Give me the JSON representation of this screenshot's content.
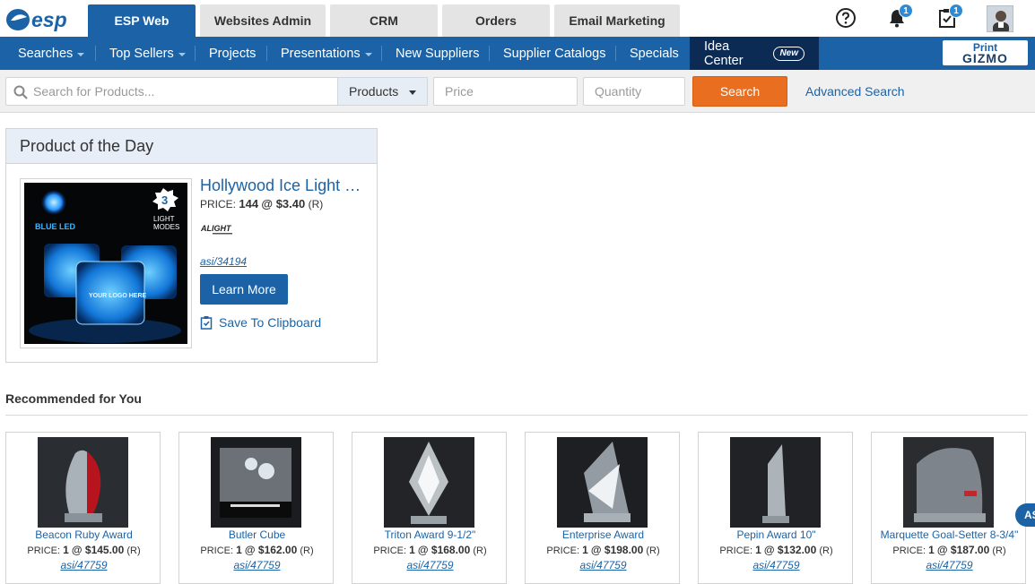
{
  "brand": {
    "logo_text": "esp"
  },
  "app_tabs": [
    {
      "label": "ESP Web",
      "active": true
    },
    {
      "label": "Websites Admin",
      "active": false
    },
    {
      "label": "CRM",
      "active": false
    },
    {
      "label": "Orders",
      "active": false
    },
    {
      "label": "Email Marketing",
      "active": false
    }
  ],
  "header_icons": {
    "help": "help-icon",
    "notifications": {
      "icon": "bell-icon",
      "count": "1"
    },
    "tasks": {
      "icon": "clipboard-check-icon",
      "count": "1"
    }
  },
  "nav": {
    "items": [
      {
        "label": "Searches",
        "dropdown": true
      },
      {
        "label": "Top Sellers",
        "dropdown": true
      },
      {
        "label": "Projects",
        "dropdown": false
      },
      {
        "label": "Presentations",
        "dropdown": true
      },
      {
        "label": "New Suppliers",
        "dropdown": false
      },
      {
        "label": "Supplier Catalogs",
        "dropdown": false
      },
      {
        "label": "Specials",
        "dropdown": false
      }
    ],
    "idea_center": {
      "label": "Idea Center",
      "badge": "New"
    },
    "print_gizmo": {
      "line1": "Print",
      "line2": "GIZMO"
    }
  },
  "search": {
    "placeholder": "Search for Products...",
    "type_selected": "Products",
    "price_placeholder": "Price",
    "quantity_placeholder": "Quantity",
    "button_label": "Search",
    "advanced_label": "Advanced Search"
  },
  "product_of_day": {
    "heading": "Product of the Day",
    "title": "Hollywood Ice Light Cubes",
    "price_label": "PRICE:",
    "price_qty": "144",
    "price_value": "@ $3.40",
    "price_code": "(R)",
    "asi": "asi/34194",
    "learn_more": "Learn More",
    "clipboard": "Save To Clipboard",
    "image_text": {
      "led": "BLUE LED",
      "modes_num": "3",
      "modes_line1": "LIGHT",
      "modes_line2": "MODES",
      "cube_logo": "YOUR LOGO HERE"
    },
    "supplier_logo_text": "ALIGHT"
  },
  "recommended": {
    "heading": "Recommended for You",
    "items": [
      {
        "name": "Beacon Ruby Award",
        "price_label": "PRICE:",
        "qty": "1",
        "price": "@ $145.00",
        "code": "(R)",
        "asi": "asi/47759"
      },
      {
        "name": "Butler Cube",
        "price_label": "PRICE:",
        "qty": "1",
        "price": "@ $162.00",
        "code": "(R)",
        "asi": "asi/47759"
      },
      {
        "name": "Triton Award 9-1/2\"",
        "price_label": "PRICE:",
        "qty": "1",
        "price": "@ $168.00",
        "code": "(R)",
        "asi": "asi/47759"
      },
      {
        "name": "Enterprise Award",
        "price_label": "PRICE:",
        "qty": "1",
        "price": "@ $198.00",
        "code": "(R)",
        "asi": "asi/47759"
      },
      {
        "name": "Pepin Award 10\"",
        "price_label": "PRICE:",
        "qty": "1",
        "price": "@ $132.00",
        "code": "(R)",
        "asi": "asi/47759"
      },
      {
        "name": "Marquette Goal-Setter 8-3/4\"",
        "price_label": "PRICE:",
        "qty": "1",
        "price": "@ $187.00",
        "code": "(R)",
        "asi": "asi/47759"
      }
    ]
  },
  "chat_bubble": "AS",
  "colors": {
    "primary": "#1b63a6",
    "nav_dark": "#0c2b54",
    "search_button": "#ea6e1f",
    "potd_header": "#e8eef7"
  }
}
